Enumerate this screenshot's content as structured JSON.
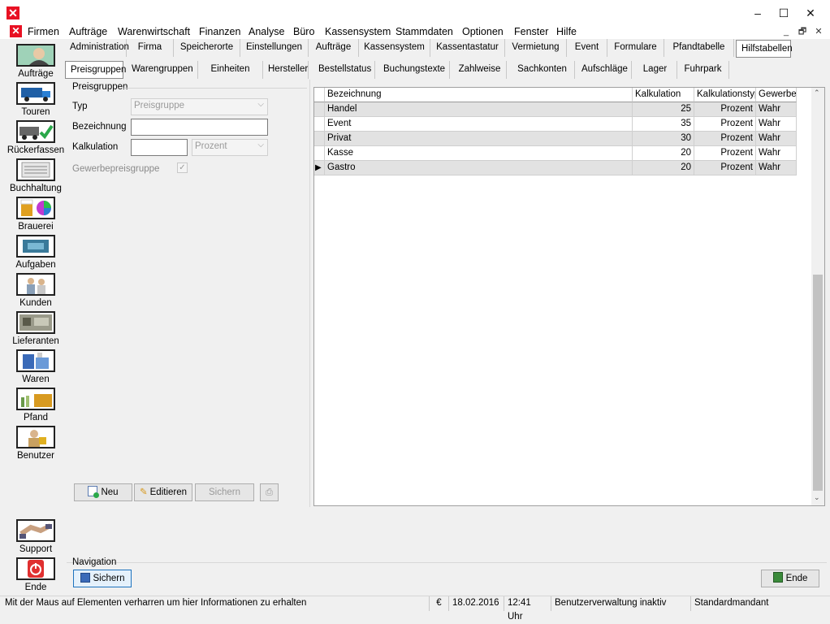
{
  "menu": [
    "Firmen",
    "Aufträge",
    "Warenwirtschaft",
    "Finanzen",
    "Analyse",
    "Büro",
    "Kassensystem",
    "Stammdaten",
    "Optionen",
    "Fenster",
    "Hilfe"
  ],
  "window_controls": {
    "minimize": "–",
    "maximize": "☐",
    "close": "✕"
  },
  "mdi_controls": {
    "minimize": "_",
    "restore": "🗗",
    "close": "✕"
  },
  "sidebar": [
    {
      "label": "Aufträge",
      "icon": "headset-agent-icon"
    },
    {
      "label": "Touren",
      "icon": "truck-icon"
    },
    {
      "label": "Rückerfassen",
      "icon": "truck-check-icon"
    },
    {
      "label": "Buchhaltung",
      "icon": "ledger-icon"
    },
    {
      "label": "Brauerei",
      "icon": "beer-color-icon"
    },
    {
      "label": "Aufgaben",
      "icon": "tasks-icon"
    },
    {
      "label": "Kunden",
      "icon": "customers-icon"
    },
    {
      "label": "Lieferanten",
      "icon": "suppliers-icon"
    },
    {
      "label": "Waren",
      "icon": "goods-icon"
    },
    {
      "label": "Pfand",
      "icon": "deposit-icon"
    },
    {
      "label": "Benutzer",
      "icon": "user-lock-icon"
    }
  ],
  "sidebar_bottom": [
    {
      "label": "Support",
      "icon": "handshake-icon"
    },
    {
      "label": "Ende",
      "icon": "power-icon"
    }
  ],
  "tabs_row1": [
    "Administration",
    "Firma",
    "Speicherorte",
    "Einstellungen",
    "Aufträge",
    "Kassensystem",
    "Kassentastatur",
    "Vermietung",
    "Event",
    "Formulare",
    "Pfandtabelle",
    "Hilfstabellen"
  ],
  "tabs_row2": [
    "Preisgruppen",
    "Warengruppen",
    "Einheiten",
    "Hersteller",
    "Bestellstatus",
    "Buchungstexte",
    "Zahlweise",
    "Sachkonten",
    "Aufschläge",
    "Lager",
    "Fuhrpark"
  ],
  "form": {
    "group_title": "Preisgruppen",
    "typ_label": "Typ",
    "typ_value": "Preisgruppe",
    "bezeichnung_label": "Bezeichnung",
    "bezeichnung_value": "",
    "kalkulation_label": "Kalkulation",
    "kalkulation_value": "",
    "kalkulation_type": "Prozent",
    "gewerbe_label": "Gewerbepreisgruppe",
    "gewerbe_checked": "✓"
  },
  "buttons": {
    "neu": "Neu",
    "editieren": "Editieren",
    "sichern": "Sichern",
    "nav_sichern": "Sichern",
    "ende": "Ende"
  },
  "navigation_label": "Navigation",
  "grid": {
    "columns": [
      "Bezeichnung",
      "Kalkulation",
      "Kalkulationstyp",
      "Gewerbe"
    ],
    "rows": [
      [
        "Handel",
        "25",
        "Prozent",
        "Wahr"
      ],
      [
        "Event",
        "35",
        "Prozent",
        "Wahr"
      ],
      [
        "Privat",
        "30",
        "Prozent",
        "Wahr"
      ],
      [
        "Kasse",
        "20",
        "Prozent",
        "Wahr"
      ],
      [
        "Gastro",
        "20",
        "Prozent",
        "Wahr"
      ]
    ],
    "current_row_marker": "▶"
  },
  "status": {
    "hint": "Mit der Maus auf Elementen verharren um hier Informationen zu erhalten",
    "currency": "€",
    "date": "18.02.2016",
    "time": "12:41 Uhr",
    "user_admin": "Benutzerverwaltung inaktiv",
    "mandant": "Standardmandant"
  },
  "colors": {
    "accent": "#1e73be",
    "app_icon": "#e81123",
    "grid_alt_row": "#e2e2e2"
  }
}
